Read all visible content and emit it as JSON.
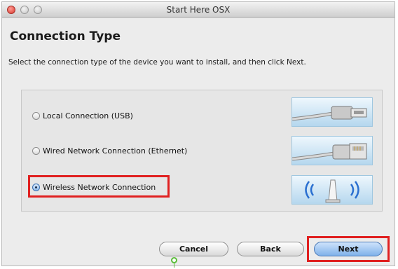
{
  "window": {
    "title": "Start Here OSX"
  },
  "page": {
    "title": "Connection Type",
    "instruction": "Select the connection type of the device you want to install, and then click Next."
  },
  "options": [
    {
      "label": "Local Connection (USB)",
      "selected": false,
      "icon": "usb-cable-icon"
    },
    {
      "label": "Wired Network Connection (Ethernet)",
      "selected": false,
      "icon": "ethernet-cable-icon"
    },
    {
      "label": "Wireless Network Connection",
      "selected": true,
      "icon": "wireless-access-point-icon"
    }
  ],
  "buttons": {
    "cancel": "Cancel",
    "back": "Back",
    "next": "Next"
  },
  "colors": {
    "highlight": "#e02020",
    "next_button": "#7fb1ea",
    "thumbnail_bg": "#b5d7ee"
  }
}
